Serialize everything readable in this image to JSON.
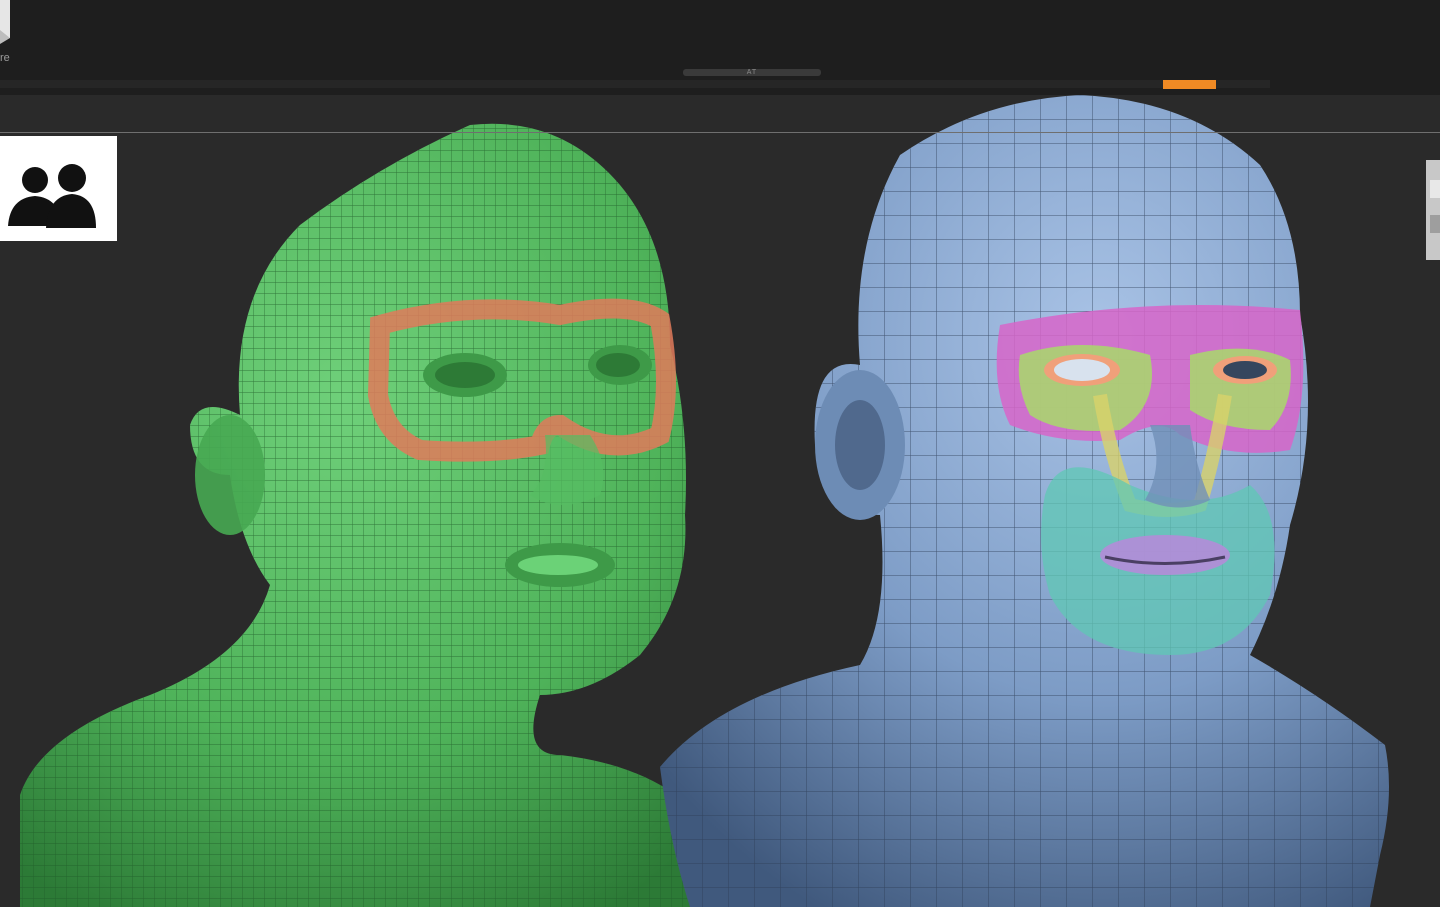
{
  "app": {
    "tool_label": "re",
    "scroll_handle_label": "AT",
    "accent_color": "#f08a24"
  },
  "viewport": {
    "background_color": "#2a2a2a",
    "models": [
      {
        "name": "green-head-mesh",
        "color": "#4fb35a",
        "highlight_color": "#e07a5a"
      },
      {
        "name": "blue-head-mesh",
        "color": "#7d9cc6",
        "highlight_colors": [
          "#d765c9",
          "#a8d96a",
          "#d8d26a",
          "#5fc8b4",
          "#b48cd8"
        ]
      }
    ]
  },
  "subtool_thumbnail": {
    "icon": "two-heads-silhouette-icon"
  }
}
